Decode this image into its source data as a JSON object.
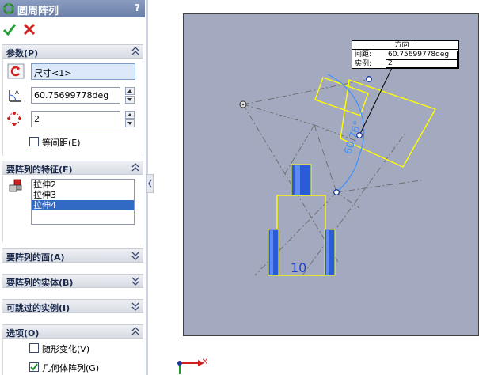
{
  "title": "圆周阵列",
  "help": "?",
  "sections": {
    "params": {
      "header": "参数(P)",
      "direction_ref": "尺寸<1>",
      "angle": "60.75699778deg",
      "instances": "2",
      "equal_spacing_label": "等间距(E)",
      "equal_spacing_checked": false
    },
    "features": {
      "header": "要阵列的特征(F)",
      "items": [
        "拉伸2",
        "拉伸3",
        "拉伸4"
      ],
      "selected": "拉伸4"
    },
    "faces": {
      "header": "要阵列的面(A)"
    },
    "bodies": {
      "header": "要阵列的实体(B)"
    },
    "skip": {
      "header": "可跳过的实例(I)"
    },
    "options": {
      "header": "选项(O)",
      "vary_sketch_label": "随形变化(V)",
      "vary_sketch_checked": false,
      "geometry_pattern_label": "几何体阵列(G)",
      "geometry_pattern_checked": true
    }
  },
  "callout": {
    "title": "方向一",
    "spacing_label": "间距:",
    "spacing_value": "60.75699778deg",
    "instances_label": "实例:",
    "instances_value": "2"
  },
  "canvas": {
    "dimension_label": "10",
    "angle_label": "60.76°"
  },
  "triad": {
    "x_label": "X"
  },
  "colors": {
    "title_bar": "#6b7fa8",
    "viewport_bg": "#a3a9bf",
    "selection_yellow": "#ffff00",
    "blue_body": "#1f5fd0",
    "list_highlight": "#316ac5"
  }
}
